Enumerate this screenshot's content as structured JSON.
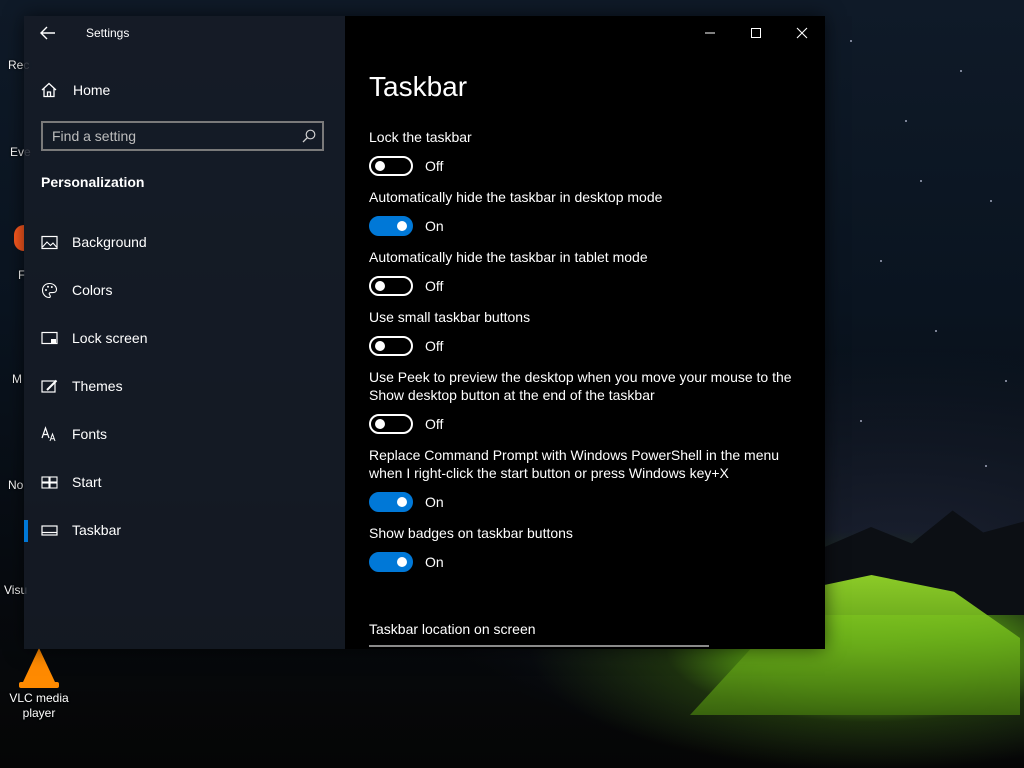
{
  "desktop": {
    "icons": [
      {
        "label": "Rec"
      },
      {
        "label": "Eve"
      },
      {
        "label": "F"
      },
      {
        "label": "M"
      },
      {
        "label": "No"
      },
      {
        "label": "Visu"
      },
      {
        "label": "VLC media player"
      }
    ]
  },
  "window": {
    "title": "Settings",
    "back_icon": "back-arrow-icon"
  },
  "nav": {
    "home_label": "Home",
    "search_placeholder": "Find a setting",
    "section_title": "Personalization",
    "items": [
      {
        "label": "Background",
        "icon": "picture-icon"
      },
      {
        "label": "Colors",
        "icon": "palette-icon"
      },
      {
        "label": "Lock screen",
        "icon": "lock-screen-icon"
      },
      {
        "label": "Themes",
        "icon": "themes-icon"
      },
      {
        "label": "Fonts",
        "icon": "fonts-icon"
      },
      {
        "label": "Start",
        "icon": "start-icon"
      },
      {
        "label": "Taskbar",
        "icon": "taskbar-icon",
        "selected": true
      }
    ]
  },
  "content": {
    "page_title": "Taskbar",
    "settings": [
      {
        "label": "Lock the taskbar",
        "state": "Off"
      },
      {
        "label": "Automatically hide the taskbar in desktop mode",
        "state": "On"
      },
      {
        "label": "Automatically hide the taskbar in tablet mode",
        "state": "Off"
      },
      {
        "label": "Use small taskbar buttons",
        "state": "Off"
      },
      {
        "label": "Use Peek to preview the desktop when you move your mouse to the Show desktop button at the end of the taskbar",
        "state": "Off"
      },
      {
        "label": "Replace Command Prompt with Windows PowerShell in the menu when I right-click the start button or press Windows key+X",
        "state": "On"
      },
      {
        "label": "Show badges on taskbar buttons",
        "state": "On"
      }
    ],
    "location_label": "Taskbar location on screen"
  },
  "colors": {
    "accent": "#0078d7"
  }
}
